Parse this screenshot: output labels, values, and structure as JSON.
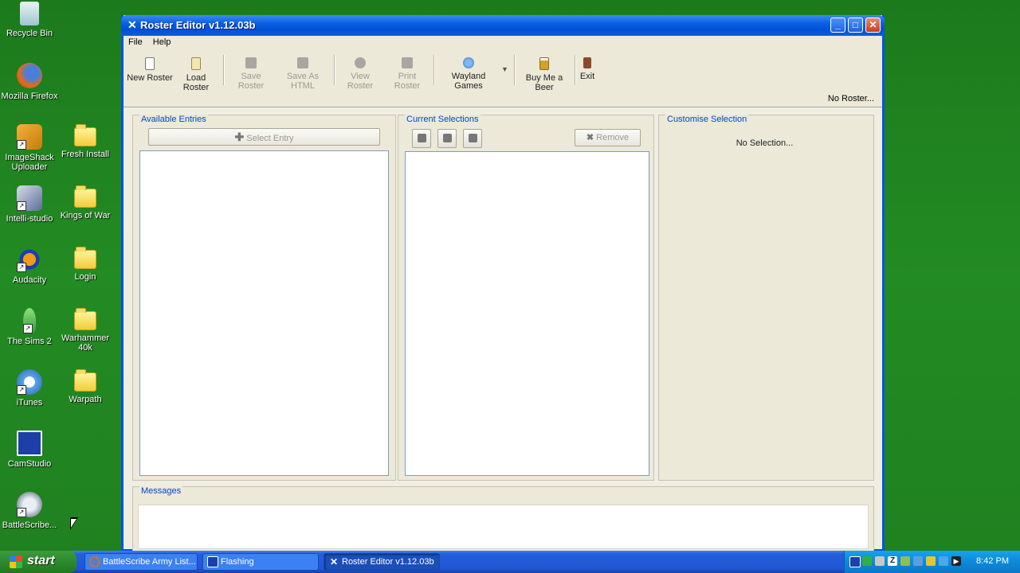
{
  "desktop": {
    "icons": [
      {
        "label": "Recycle Bin"
      },
      {
        "label": "Mozilla Firefox"
      },
      {
        "label": "ImageShack Uploader"
      },
      {
        "label": "Fresh Install"
      },
      {
        "label": "Intelli-studio"
      },
      {
        "label": "Kings of War"
      },
      {
        "label": "Audacity"
      },
      {
        "label": "Login"
      },
      {
        "label": "The Sims 2"
      },
      {
        "label": "Warhammer 40k"
      },
      {
        "label": "iTunes"
      },
      {
        "label": "Warpath"
      },
      {
        "label": "CamStudio"
      },
      {
        "label": "BattleScribe..."
      }
    ]
  },
  "window": {
    "title": "Roster Editor v1.12.03b",
    "menu": [
      "File",
      "Help"
    ],
    "toolbar": [
      {
        "label": "New Roster",
        "enabled": true,
        "icon": "new-document-icon"
      },
      {
        "label": "Load Roster",
        "enabled": true,
        "icon": "open-document-icon"
      },
      {
        "label": "Save Roster",
        "enabled": false,
        "icon": "save-icon"
      },
      {
        "label": "Save As HTML",
        "enabled": false,
        "icon": "save-html-icon"
      },
      {
        "label": "View Roster",
        "enabled": false,
        "icon": "magnifier-icon"
      },
      {
        "label": "Print Roster",
        "enabled": false,
        "icon": "printer-icon"
      },
      {
        "label": "Wayland Games",
        "enabled": true,
        "icon": "globe-icon"
      },
      {
        "label": "Buy Me a Beer",
        "enabled": true,
        "icon": "beer-icon"
      },
      {
        "label": "Exit",
        "enabled": true,
        "icon": "exit-door-icon"
      }
    ],
    "status": "No Roster...",
    "panels": {
      "available": {
        "title": "Available Entries",
        "select_button": "Select Entry"
      },
      "current": {
        "title": "Current Selections",
        "remove_button": "Remove"
      },
      "customise": {
        "title": "Customise Selection",
        "empty_text": "No Selection..."
      },
      "messages": {
        "title": "Messages"
      }
    }
  },
  "taskbar": {
    "start": "start",
    "tasks": [
      {
        "label": "BattleScribe Army List..."
      },
      {
        "label": "Flashing"
      },
      {
        "label": "Roster Editor v1.12.03b"
      }
    ],
    "clock": "8:42 PM"
  }
}
